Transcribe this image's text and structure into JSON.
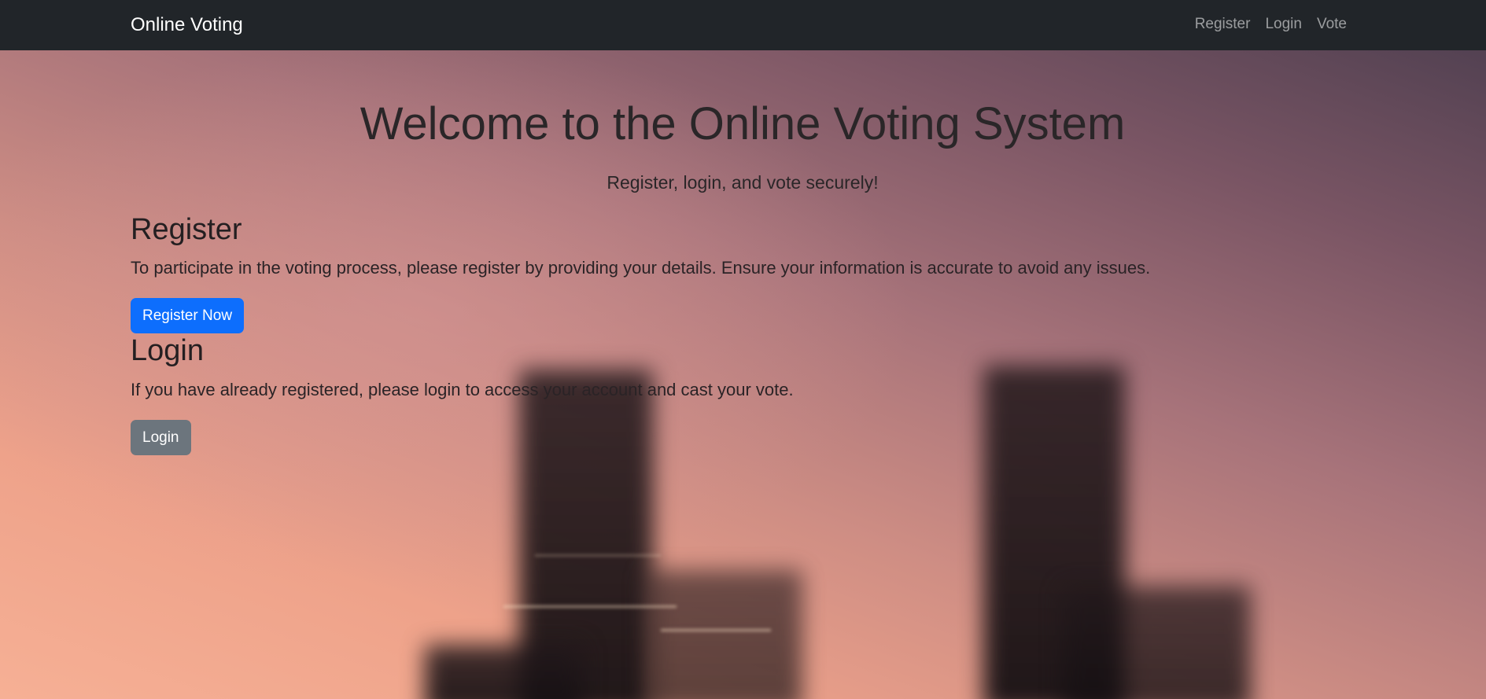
{
  "navbar": {
    "brand": "Online Voting",
    "links": [
      {
        "label": "Register"
      },
      {
        "label": "Login"
      },
      {
        "label": "Vote"
      }
    ]
  },
  "hero": {
    "title": "Welcome to the Online Voting System",
    "subtitle": "Register, login, and vote securely!"
  },
  "register": {
    "heading": "Register",
    "text": "To participate in the voting process, please register by providing your details. Ensure your information is accurate to avoid any issues.",
    "button_label": "Register Now"
  },
  "login": {
    "heading": "Login",
    "text": "If you have already registered, please login to access your account and cast your vote.",
    "button_label": "Login"
  },
  "colors": {
    "navbar_bg": "#212529",
    "primary_button": "#0d6efd",
    "secondary_button": "#6c757d"
  }
}
